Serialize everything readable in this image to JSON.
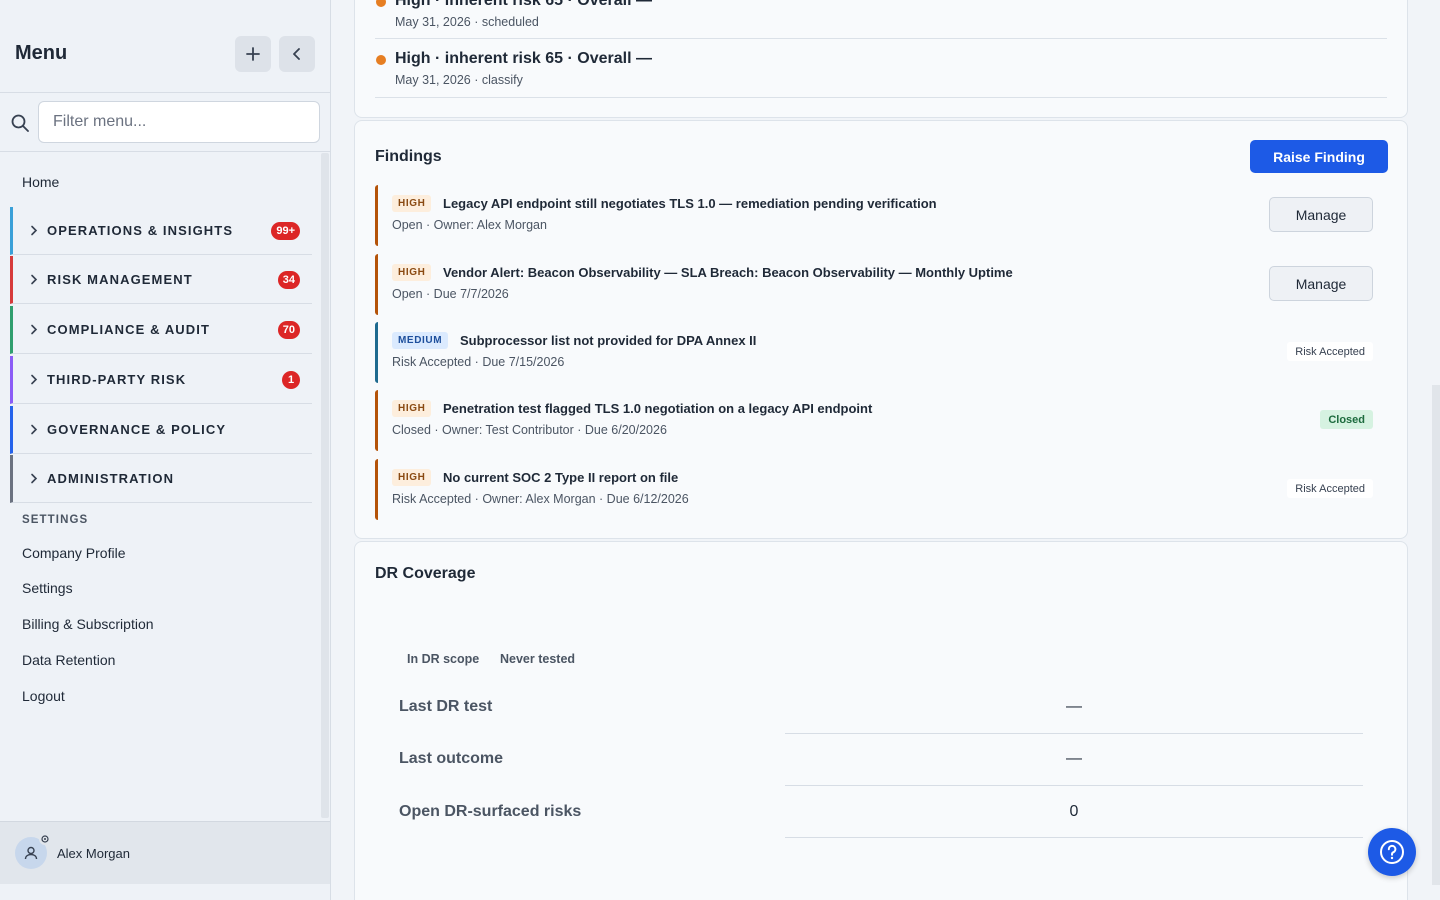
{
  "sidebar": {
    "title": "Menu",
    "filter_placeholder": "Filter menu...",
    "home": "Home",
    "groups": [
      {
        "label": "OPERATIONS & INSIGHTS",
        "badge": "99+",
        "accent": "#3aa0d8"
      },
      {
        "label": "RISK MANAGEMENT",
        "badge": "34",
        "accent": "#d63b3b"
      },
      {
        "label": "COMPLIANCE & AUDIT",
        "badge": "70",
        "accent": "#2f9e6e"
      },
      {
        "label": "THIRD-PARTY RISK",
        "badge": "1",
        "accent": "#8b5cf6"
      },
      {
        "label": "GOVERNANCE & POLICY",
        "badge": "",
        "accent": "#2563eb"
      },
      {
        "label": "ADMINISTRATION",
        "badge": "",
        "accent": "#6b7280"
      }
    ],
    "settings_heading": "SETTINGS",
    "settings_items": [
      "Company Profile",
      "Settings",
      "Billing & Subscription",
      "Data Retention",
      "Logout"
    ],
    "user_name": "Alex Morgan"
  },
  "activity": [
    {
      "title": "High · inherent risk 65 · Overall —",
      "sub": "May 31, 2026 · scheduled"
    },
    {
      "title": "High · inherent risk 65 · Overall —",
      "sub": "May 31, 2026 · classify"
    }
  ],
  "findings": {
    "title": "Findings",
    "raise_label": "Raise Finding",
    "items": [
      {
        "severity": "HIGH",
        "title": "Legacy API endpoint still negotiates TLS 1.0 — remediation pending verification",
        "meta": "Open · Owner: Alex Morgan",
        "action": "Manage",
        "accent": "#b45309"
      },
      {
        "severity": "HIGH",
        "title": "Vendor Alert: Beacon Observability — SLA Breach: Beacon Observability — Monthly Uptime",
        "meta": "Open · Due 7/7/2026",
        "action": "Manage",
        "accent": "#b45309"
      },
      {
        "severity": "MEDIUM",
        "title": "Subprocessor list not provided for DPA Annex II",
        "meta": "Risk Accepted · Due 7/15/2026",
        "status": "Risk Accepted",
        "accent": "#1e6a8f"
      },
      {
        "severity": "HIGH",
        "title": "Penetration test flagged TLS 1.0 negotiation on a legacy API endpoint",
        "meta": "Closed · Owner: Test Contributor · Due 6/20/2026",
        "status": "Closed",
        "accent": "#b45309"
      },
      {
        "severity": "HIGH",
        "title": "No current SOC 2 Type II report on file",
        "meta": "Risk Accepted · Owner: Alex Morgan · Due 6/12/2026",
        "status": "Risk Accepted",
        "accent": "#b45309"
      }
    ]
  },
  "dr": {
    "title": "DR Coverage",
    "tags": [
      "In DR scope",
      "Never tested"
    ],
    "rows": [
      {
        "label": "Last DR test",
        "value": "—"
      },
      {
        "label": "Last outcome",
        "value": "—"
      },
      {
        "label": "Open DR-surfaced risks",
        "value": "0"
      }
    ]
  },
  "colors": {
    "primary": "#1d5ae6",
    "badge_red": "#dc2626",
    "activity_dot": "#e67e22"
  }
}
